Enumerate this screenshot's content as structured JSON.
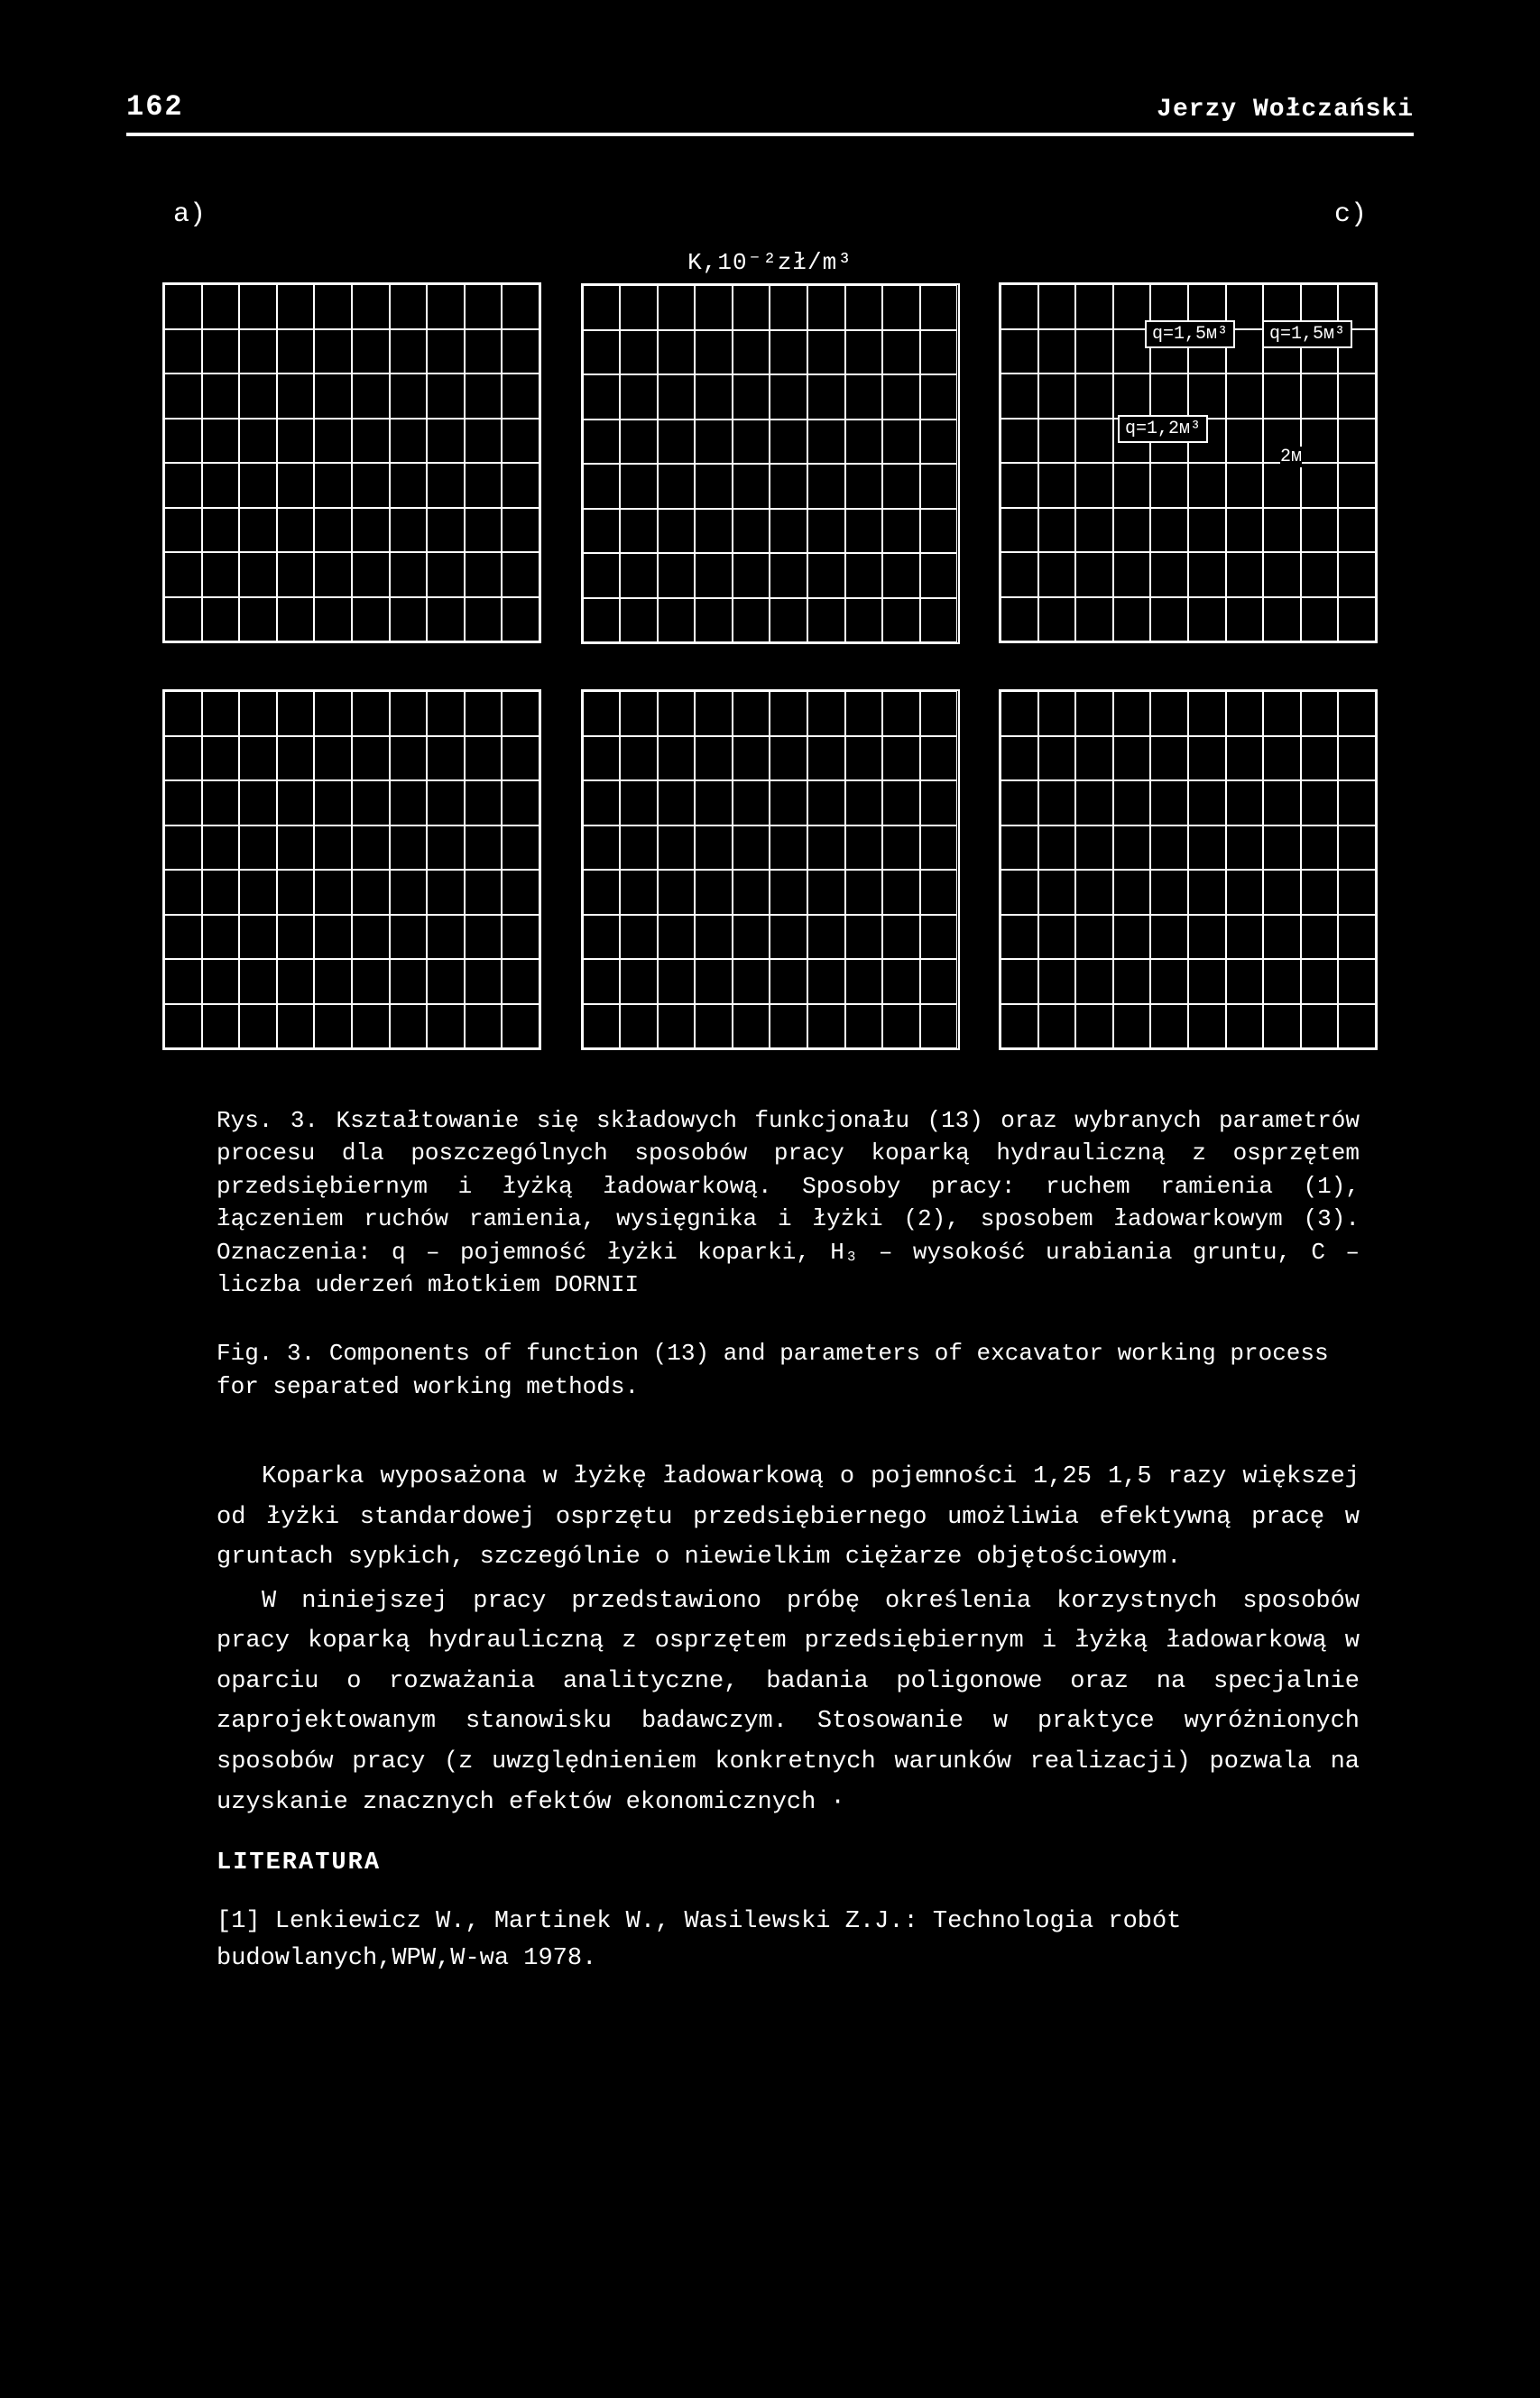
{
  "page_number": "162",
  "author": "Jerzy Wołczański",
  "figure_labels": {
    "left": "a)",
    "right": "c)",
    "ylabel": "K,10⁻²zł/m³"
  },
  "chart_c_annotations": {
    "q1": "q=1,5м³",
    "q2": "q=1,5м³",
    "q3": "q=1,2м³",
    "q4": "2м"
  },
  "caption_pl_label": "Rys. 3.",
  "caption_pl": "Kształtowanie się składowych funkcjonału (13) oraz wybranych parametrów procesu dla poszczególnych sposobów pracy koparką hydrauliczną z osprzętem przedsiębiernym i łyżką ładowarkową. Sposoby pracy: ruchem ramienia (1), łączeniem ruchów ramienia, wysięgnika i łyżki (2), sposobem ładowarkowym (3). Oznaczenia: q – pojemność łyżki koparki, H₃ – wysokość urabiania gruntu, C – liczba uderzeń młotkiem DORNII",
  "caption_en_label": "Fig. 3.",
  "caption_en": "Components of function (13) and parameters of excavator working process for separated working methods.",
  "para1": "Koparka wyposażona w łyżkę ładowarkową o pojemności 1,25   1,5 razy większej od łyżki standardowej osprzętu przedsiębiernego umożliwia efektywną pracę w gruntach sypkich, szczególnie o niewielkim ciężarze objętościowym.",
  "para2": "W niniejszej pracy przedstawiono próbę określenia korzystnych sposobów pracy koparką hydrauliczną z osprzętem przedsiębiernym i łyżką ładowarkową w oparciu o rozważania analityczne, badania poligonowe oraz na specjalnie zaprojektowanym stanowisku badawczym. Stosowanie w praktyce wyróżnionych sposobów pracy (z uwzględnieniem konkretnych warunków realizacji) pozwala na uzyskanie znacznych efektów ekonomicznych ·",
  "literature_heading": "LITERATURA",
  "ref1": "[1] Lenkiewicz W., Martinek W., Wasilewski Z.J.: Technologia robót budowlanych,WPW,W-wa 1978.",
  "chart_data": [
    {
      "id": "a_top_left",
      "type": "line",
      "xlabel": "",
      "ylabel": "K,10⁻²zł/m³",
      "series": [],
      "note": "grid image, no readable numeric ticks"
    },
    {
      "id": "b_top_mid",
      "type": "line",
      "xlabel": "",
      "ylabel": "K,10⁻²zł/m³",
      "series": [],
      "note": "grid image, no readable numeric ticks"
    },
    {
      "id": "c_top_right",
      "type": "line",
      "xlabel": "",
      "ylabel": "",
      "annotations": [
        "q=1,5м³",
        "q=1,5м³",
        "q=1,2м³",
        "2м"
      ],
      "series": [],
      "note": "grid image with parameter labels"
    },
    {
      "id": "a_bottom_left",
      "type": "line",
      "series": [],
      "note": "grid image, no readable numeric ticks"
    },
    {
      "id": "b_bottom_mid",
      "type": "line",
      "series": [],
      "note": "grid image, no readable numeric ticks"
    },
    {
      "id": "c_bottom_right",
      "type": "line",
      "series": [],
      "note": "grid image, no readable numeric ticks"
    }
  ]
}
